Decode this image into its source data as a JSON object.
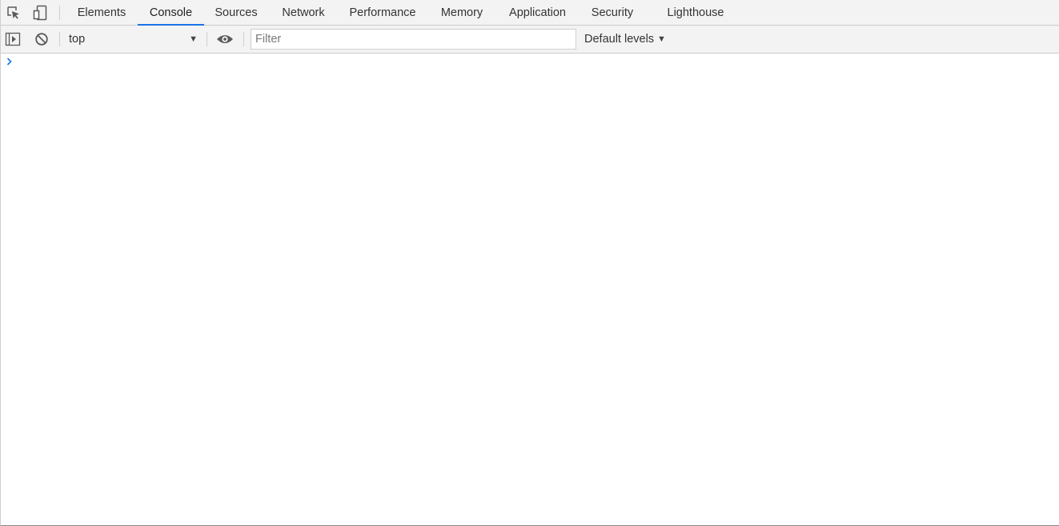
{
  "tabbar": {
    "tabs": [
      {
        "label": "Elements",
        "active": false
      },
      {
        "label": "Console",
        "active": true
      },
      {
        "label": "Sources",
        "active": false
      },
      {
        "label": "Network",
        "active": false
      },
      {
        "label": "Performance",
        "active": false
      },
      {
        "label": "Memory",
        "active": false
      },
      {
        "label": "Application",
        "active": false
      },
      {
        "label": "Security",
        "active": false
      },
      {
        "label": "Lighthouse",
        "active": false
      }
    ],
    "icons": [
      "inspect-element-icon",
      "device-toolbar-icon"
    ]
  },
  "toolbar": {
    "icons": [
      "show-sidebar-icon",
      "clear-console-icon",
      "live-expression-eye-icon"
    ],
    "context": "top",
    "filter_placeholder": "Filter",
    "filter_value": "",
    "levels_label": "Default levels"
  },
  "console": {
    "prompt_icon": "chevron-right-icon"
  },
  "colors": {
    "accent": "#1a73e8",
    "toolbar_bg": "#f3f3f3",
    "border": "#cbcbcb",
    "icon": "#5a5a5a"
  }
}
